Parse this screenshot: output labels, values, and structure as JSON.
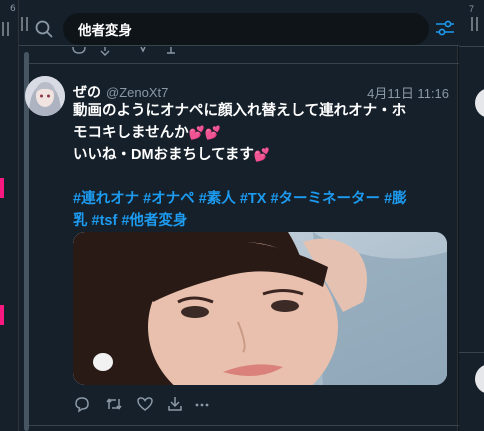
{
  "left_column": {
    "number": "6"
  },
  "right_column": {
    "number": "7"
  },
  "search": {
    "query": "他者変身"
  },
  "tweet": {
    "display_name": "ぜの",
    "handle": "@ZenoXt7",
    "timestamp": "4月11日 11:16",
    "line1": "動画のようにオナペに顔入れ替えして連れオナ・ホ",
    "line2": "モコキしませんか",
    "line3": "いいね・DMおまちしてます",
    "hashtags_line1": [
      "#連れオナ",
      "#オナペ",
      "#素人",
      "#TX",
      "#ターミネーター",
      "#膨"
    ],
    "hashtags_line2": [
      "乳",
      "#tsf",
      "#他者変身"
    ]
  },
  "icons": [
    "search-icon",
    "filter-icon",
    "reply-icon",
    "retweet-icon",
    "like-icon",
    "share-icon",
    "more-icon"
  ],
  "colors": {
    "accent": "#1d9bf0",
    "background": "#15202b",
    "dark": "#0f1419",
    "heart": "#f4508b"
  }
}
